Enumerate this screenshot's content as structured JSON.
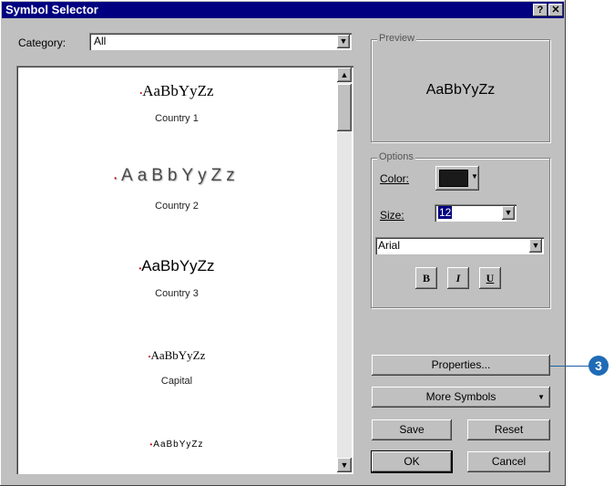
{
  "window": {
    "title": "Symbol Selector",
    "help_icon": "?",
    "close_icon": "✕"
  },
  "category": {
    "label": "Category:",
    "value": "All"
  },
  "symbols": [
    {
      "sample": "AaBbYyZz",
      "name": "Country 1"
    },
    {
      "sample": "AaBbYyZz",
      "name": "Country 2"
    },
    {
      "sample": "AaBbYyZz",
      "name": "Country 3"
    },
    {
      "sample": "AaBbYyZz",
      "name": "Capital"
    },
    {
      "sample": "AaBbYyZz",
      "name": ""
    }
  ],
  "preview": {
    "legend": "Preview",
    "sample": "AaBbYyZz"
  },
  "options": {
    "legend": "Options",
    "color_label": "Color:",
    "color_value": "#1a1a1a",
    "size_label": "Size:",
    "size_value": "12",
    "font_value": "Arial",
    "bold": "B",
    "italic": "I",
    "underline": "U"
  },
  "buttons": {
    "properties": "Properties...",
    "more_symbols": "More Symbols",
    "save": "Save",
    "reset": "Reset",
    "ok": "OK",
    "cancel": "Cancel"
  },
  "callout": {
    "number": "3"
  }
}
